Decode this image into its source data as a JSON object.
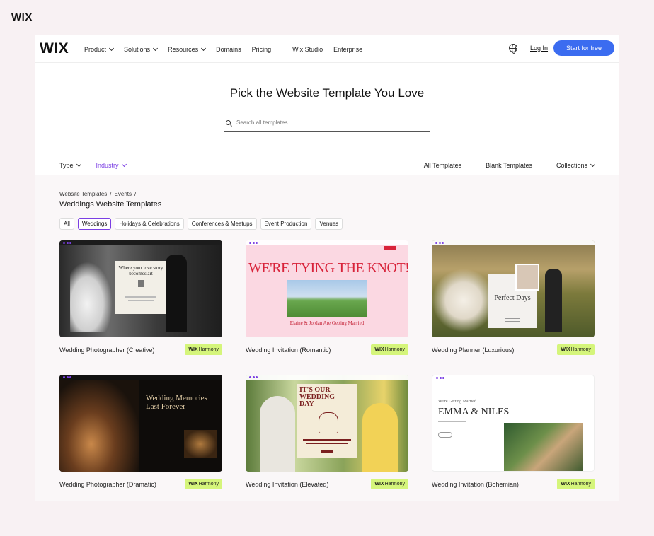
{
  "outer": {
    "logo": "WIX"
  },
  "nav": {
    "logo": "WIX",
    "links": [
      {
        "label": "Product",
        "dropdown": true
      },
      {
        "label": "Solutions",
        "dropdown": true
      },
      {
        "label": "Resources",
        "dropdown": true
      },
      {
        "label": "Domains",
        "dropdown": false
      },
      {
        "label": "Pricing",
        "dropdown": false
      },
      {
        "label": "Wix Studio",
        "dropdown": false
      },
      {
        "label": "Enterprise",
        "dropdown": false
      }
    ],
    "login": "Log In",
    "cta": "Start for free"
  },
  "hero": {
    "title": "Pick the Website Template You Love",
    "search_placeholder": "Search all templates..."
  },
  "filters": {
    "left": [
      {
        "label": "Type",
        "active": false
      },
      {
        "label": "Industry",
        "active": true
      }
    ],
    "right": [
      {
        "label": "All Templates"
      },
      {
        "label": "Blank Templates"
      },
      {
        "label": "Collections"
      }
    ]
  },
  "breadcrumb": [
    "Website Templates",
    "/",
    "Events",
    "/"
  ],
  "category_title": "Weddings Website Templates",
  "chips": [
    {
      "label": "All",
      "active": false
    },
    {
      "label": "Weddings",
      "active": true
    },
    {
      "label": "Holidays & Celebrations",
      "active": false
    },
    {
      "label": "Conferences & Meetups",
      "active": false
    },
    {
      "label": "Event Production",
      "active": false
    },
    {
      "label": "Venues",
      "active": false
    }
  ],
  "badge": {
    "brand": "WIX",
    "name": "Harmony"
  },
  "templates": [
    {
      "title": "Wedding Photographer (Creative)",
      "thumb_text": "Where your love story becomes art"
    },
    {
      "title": "Wedding Invitation (Romantic)",
      "thumb_text": "WE'RE TYING THE KNOT!",
      "thumb_sub": "Elaine & Jordan Are Getting Married"
    },
    {
      "title": "Wedding Planner (Luxurious)",
      "thumb_text": "Perfect Days"
    },
    {
      "title": "Wedding Photographer (Dramatic)",
      "thumb_text": "Wedding Memories Last Forever"
    },
    {
      "title": "Wedding Invitation (Elevated)",
      "thumb_text": "IT'S OUR WEDDING DAY"
    },
    {
      "title": "Wedding Invitation (Bohemian)",
      "thumb_text": "EMMA & NILES",
      "thumb_sub": "We're Getting Married"
    }
  ],
  "colors": {
    "accent": "#7b3fe4",
    "cta": "#3b6cf0",
    "badge": "#d5f57b"
  }
}
